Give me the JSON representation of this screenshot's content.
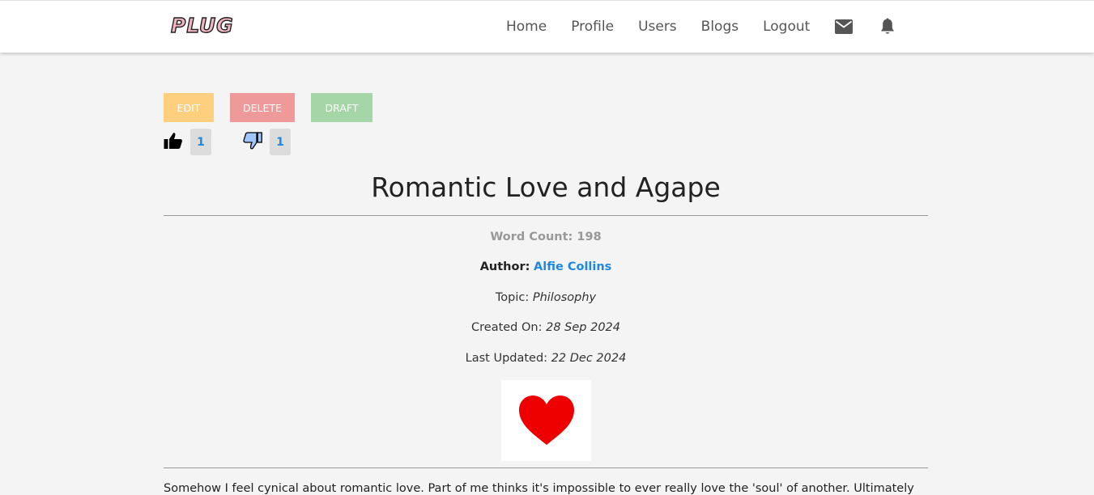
{
  "nav": {
    "logo": "PLUG",
    "links": [
      "Home",
      "Profile",
      "Users",
      "Blogs",
      "Logout"
    ],
    "icons": [
      "mail-icon",
      "bell-icon"
    ]
  },
  "actions": {
    "edit_label": "EDIT",
    "delete_label": "DELETE",
    "draft_label": "DRAFT",
    "colors": {
      "edit": "#ffcf80",
      "delete": "#ef9a9a",
      "draft": "#a5d6a7"
    }
  },
  "votes": {
    "likes": "1",
    "dislikes": "1"
  },
  "post": {
    "title": "Romantic Love and Agape",
    "word_count_label": "Word Count:",
    "word_count": "198",
    "author_label": "Author:",
    "author_name": "Alfie Collins",
    "topic_label": "Topic:",
    "topic": "Philosophy",
    "created_label": "Created On:",
    "created": "28 Sep 2024",
    "updated_label": "Last Updated:",
    "updated": "22 Dec 2024",
    "image": "heart-icon",
    "body": "Somehow I feel cynical about romantic love. Part of me thinks it's impossible to ever really love the 'soul' of another. Ultimately"
  },
  "colors": {
    "link": "#1e88e5",
    "heart": "#ee0000"
  }
}
